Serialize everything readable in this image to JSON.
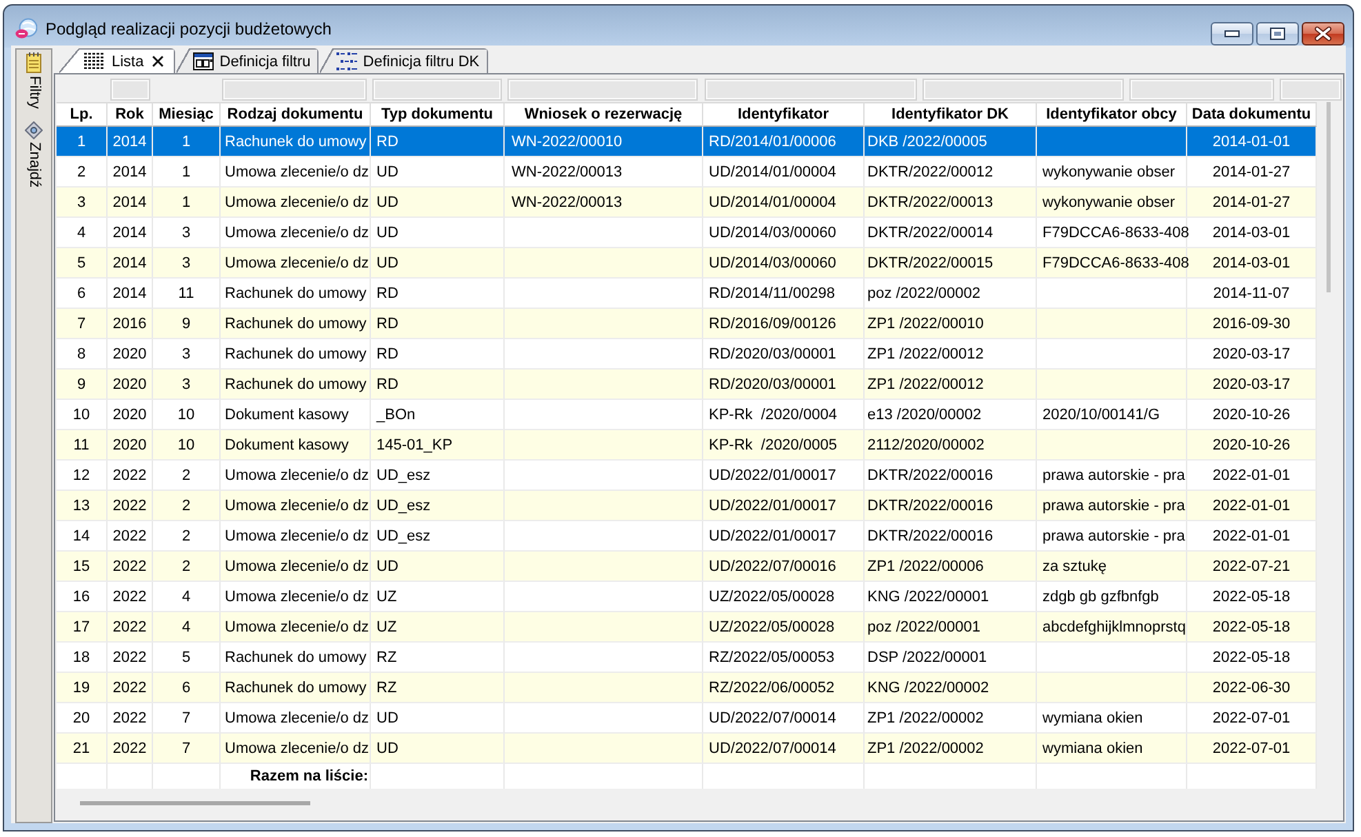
{
  "window": {
    "title": "Podgląd realizacji pozycji budżetowych"
  },
  "side_panel": {
    "items": [
      {
        "label": "Filtry"
      },
      {
        "label": "Znajdź"
      }
    ]
  },
  "tabs": [
    {
      "label": "Lista",
      "selected": true,
      "closable": true
    },
    {
      "label": "Definicja filtru",
      "selected": false,
      "closable": false
    },
    {
      "label": "Definicja filtru DK",
      "selected": false,
      "closable": false
    }
  ],
  "table": {
    "columns": [
      "Lp.",
      "Rok",
      "Miesiąc",
      "Rodzaj dokumentu",
      "Typ dokumentu",
      "Wniosek o rezerwację",
      "Identyfikator",
      "Identyfikator DK",
      "Identyfikator obcy",
      "Data dokumentu"
    ],
    "rows": [
      {
        "selected": true,
        "cells": [
          "1",
          "2014",
          "1",
          "Rachunek do umowy",
          "RD",
          "WN-2022/00010",
          "RD/2014/01/00006",
          "DKB /2022/00005",
          null,
          "2014-01-01"
        ]
      },
      {
        "selected": false,
        "cells": [
          "2",
          "2014",
          "1",
          "Umowa zlecenie/o dz",
          "UD",
          "WN-2022/00013",
          "UD/2014/01/00004",
          "DKTR/2022/00012",
          "wykonywanie obser",
          "2014-01-27"
        ]
      },
      {
        "selected": false,
        "cells": [
          "3",
          "2014",
          "1",
          "Umowa zlecenie/o dz",
          "UD",
          "WN-2022/00013",
          "UD/2014/01/00004",
          "DKTR/2022/00013",
          "wykonywanie obser",
          "2014-01-27"
        ]
      },
      {
        "selected": false,
        "cells": [
          "4",
          "2014",
          "3",
          "Umowa zlecenie/o dz",
          "UD",
          null,
          "UD/2014/03/00060",
          "DKTR/2022/00014",
          "F79DCCA6-8633-408",
          "2014-03-01"
        ]
      },
      {
        "selected": false,
        "cells": [
          "5",
          "2014",
          "3",
          "Umowa zlecenie/o dz",
          "UD",
          null,
          "UD/2014/03/00060",
          "DKTR/2022/00015",
          "F79DCCA6-8633-408",
          "2014-03-01"
        ]
      },
      {
        "selected": false,
        "cells": [
          "6",
          "2014",
          "11",
          "Rachunek do umowy",
          "RD",
          null,
          "RD/2014/11/00298",
          "poz /2022/00002",
          null,
          "2014-11-07"
        ]
      },
      {
        "selected": false,
        "cells": [
          "7",
          "2016",
          "9",
          "Rachunek do umowy",
          "RD",
          null,
          "RD/2016/09/00126",
          "ZP1 /2022/00010",
          null,
          "2016-09-30"
        ]
      },
      {
        "selected": false,
        "cells": [
          "8",
          "2020",
          "3",
          "Rachunek do umowy",
          "RD",
          null,
          "RD/2020/03/00001",
          "ZP1 /2022/00012",
          null,
          "2020-03-17"
        ]
      },
      {
        "selected": false,
        "cells": [
          "9",
          "2020",
          "3",
          "Rachunek do umowy",
          "RD",
          null,
          "RD/2020/03/00001",
          "ZP1 /2022/00012",
          null,
          "2020-03-17"
        ]
      },
      {
        "selected": false,
        "cells": [
          "10",
          "2020",
          "10",
          "Dokument kasowy",
          "_BOn",
          null,
          "KP-Rk  /2020/0004",
          "e13 /2020/00002",
          "2020/10/00141/G",
          "2020-10-26"
        ]
      },
      {
        "selected": false,
        "cells": [
          "11",
          "2020",
          "10",
          "Dokument kasowy",
          "145-01_KP",
          null,
          "KP-Rk  /2020/0005",
          "2112/2020/00002",
          null,
          "2020-10-26"
        ]
      },
      {
        "selected": false,
        "cells": [
          "12",
          "2022",
          "2",
          "Umowa zlecenie/o dz",
          "UD_esz",
          null,
          "UD/2022/01/00017",
          "DKTR/2022/00016",
          "prawa autorskie - pra",
          "2022-01-01"
        ]
      },
      {
        "selected": false,
        "cells": [
          "13",
          "2022",
          "2",
          "Umowa zlecenie/o dz",
          "UD_esz",
          null,
          "UD/2022/01/00017",
          "DKTR/2022/00016",
          "prawa autorskie - pra",
          "2022-01-01"
        ]
      },
      {
        "selected": false,
        "cells": [
          "14",
          "2022",
          "2",
          "Umowa zlecenie/o dz",
          "UD_esz",
          null,
          "UD/2022/01/00017",
          "DKTR/2022/00016",
          "prawa autorskie - pra",
          "2022-01-01"
        ]
      },
      {
        "selected": false,
        "cells": [
          "15",
          "2022",
          "2",
          "Umowa zlecenie/o dz",
          "UD",
          null,
          "UD/2022/07/00016",
          "ZP1 /2022/00006",
          "za sztukę",
          "2022-07-21"
        ]
      },
      {
        "selected": false,
        "cells": [
          "16",
          "2022",
          "4",
          "Umowa zlecenie/o dz",
          "UZ",
          null,
          "UZ/2022/05/00028",
          "KNG /2022/00001",
          "zdgb gb gzfbnfgb",
          "2022-05-18"
        ]
      },
      {
        "selected": false,
        "cells": [
          "17",
          "2022",
          "4",
          "Umowa zlecenie/o dz",
          "UZ",
          null,
          "UZ/2022/05/00028",
          "poz /2022/00001",
          "abcdefghijklmnoprstq",
          "2022-05-18"
        ]
      },
      {
        "selected": false,
        "cells": [
          "18",
          "2022",
          "5",
          "Rachunek do umowy",
          "RZ",
          null,
          "RZ/2022/05/00053",
          "DSP /2022/00001",
          null,
          "2022-05-18"
        ]
      },
      {
        "selected": false,
        "cells": [
          "19",
          "2022",
          "6",
          "Rachunek do umowy",
          "RZ",
          null,
          "RZ/2022/06/00052",
          "KNG /2022/00002",
          null,
          "2022-06-30"
        ]
      },
      {
        "selected": false,
        "cells": [
          "20",
          "2022",
          "7",
          "Umowa zlecenie/o dz",
          "UD",
          null,
          "UD/2022/07/00014",
          "ZP1 /2022/00002",
          "wymiana okien",
          "2022-07-01"
        ]
      },
      {
        "selected": false,
        "cells": [
          "21",
          "2022",
          "7",
          "Umowa zlecenie/o dz",
          "UD",
          null,
          "UD/2022/07/00014",
          "ZP1 /2022/00002",
          "wymiana okien",
          "2022-07-01"
        ]
      }
    ],
    "footer": {
      "label": "Razem na liście:"
    }
  }
}
